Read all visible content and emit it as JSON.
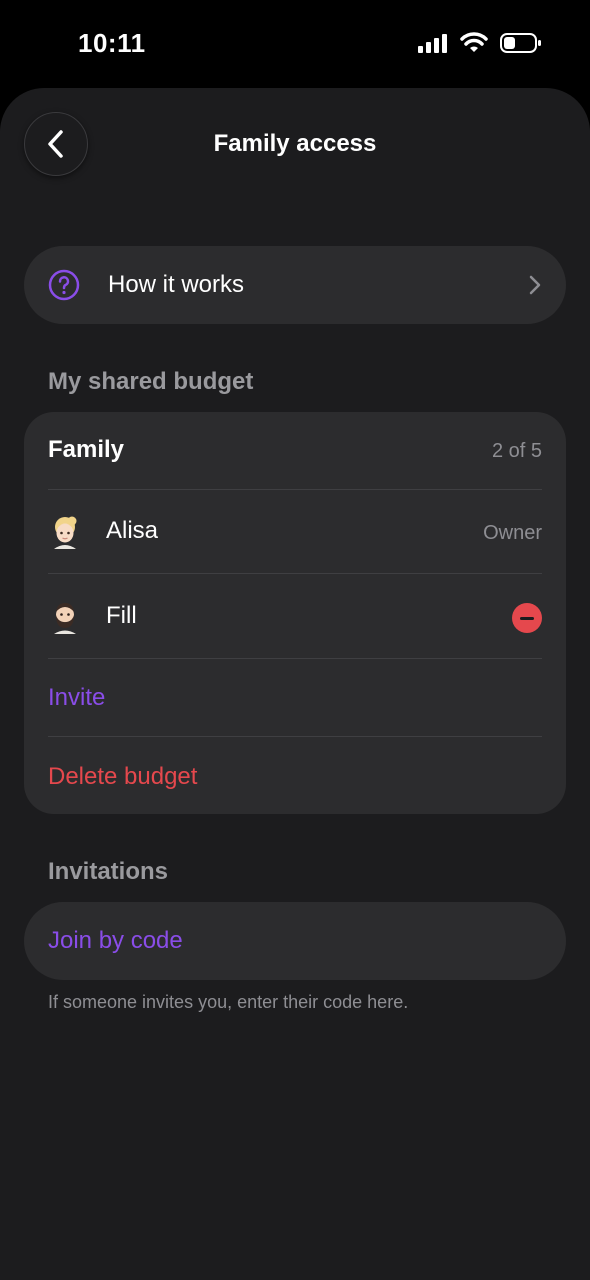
{
  "status_bar": {
    "time": "10:11",
    "icons": [
      "cellular-signal-icon",
      "wifi-icon",
      "battery-icon"
    ]
  },
  "header": {
    "back_icon": "chevron-left-icon",
    "title": "Family access"
  },
  "how_it_works": {
    "icon": "question-circle-icon",
    "label": "How it works",
    "chevron": "chevron-right-icon"
  },
  "shared_budget": {
    "section_title": "My shared budget",
    "name": "Family",
    "count": "2 of 5",
    "members": [
      {
        "name": "Alisa",
        "avatar": "woman-blonde-emoji-icon",
        "role": "Owner"
      },
      {
        "name": "Fill",
        "avatar": "man-beard-emoji-icon",
        "action_icon": "remove-circle-icon"
      }
    ],
    "invite_label": "Invite",
    "delete_label": "Delete budget"
  },
  "invitations": {
    "section_title": "Invitations",
    "join_label": "Join by code",
    "hint": "If someone invites you, enter their code here."
  },
  "colors": {
    "background": "#1c1c1e",
    "card": "#2c2c2e",
    "accent": "#8a4de8",
    "destructive": "#e5484d",
    "secondary_text": "#8e8e93"
  }
}
